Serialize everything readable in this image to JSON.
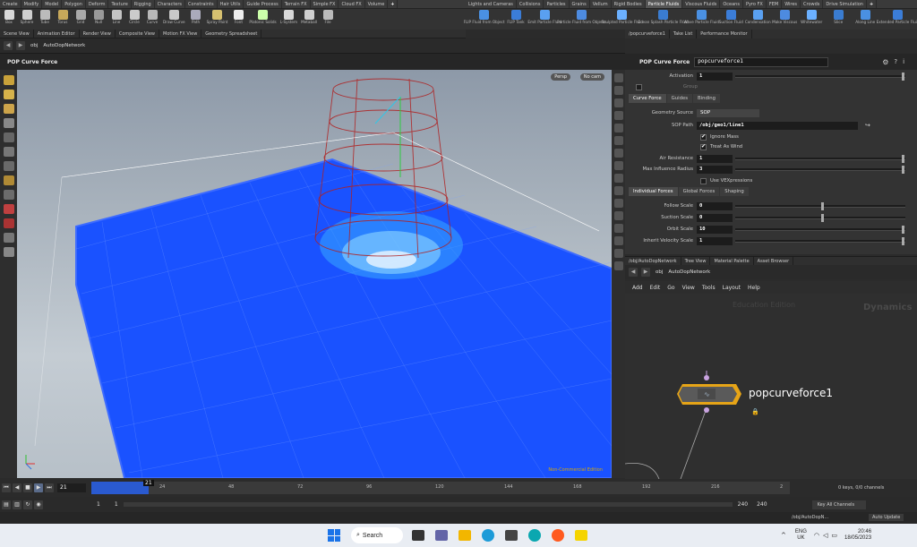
{
  "shelf_tabs_left": [
    "Create",
    "Modify",
    "Model",
    "Polygon",
    "Deform",
    "Texture",
    "Rigging",
    "Characters",
    "Constraints",
    "Hair Utils",
    "Guide Process",
    "Terrain FX",
    "Simple FX",
    "Cloud FX",
    "Volume",
    "+"
  ],
  "shelf_tabs_right": [
    "Lights and Cameras",
    "Collisions",
    "Particles",
    "Grains",
    "Vellum",
    "Rigid Bodies",
    "Particle Fluids",
    "Viscous Fluids",
    "Oceans",
    "Pyro FX",
    "FEM",
    "Wires",
    "Crowds",
    "Drive Simulation",
    "+"
  ],
  "shelf_tabs_right_active": "Particle Fluids",
  "tools_left": [
    "Box",
    "Sphere",
    "Tube",
    "Torus",
    "Grid",
    "Null",
    "Line",
    "Circle",
    "Curve",
    "Draw Curve",
    "Path",
    "Spray Paint",
    "Font",
    "Platonic Solids",
    "L-System",
    "Metaball",
    "File"
  ],
  "tools_right": [
    "FLIP Fluid from Object",
    "FLIP Tank",
    "Emit Particle Fluid",
    "Particle Fluid from Objects",
    "Sculpted Particle Fluid",
    "Ocean Splash Particle Fluid",
    "Wave Particle Fluid",
    "Suction Fluid",
    "Condensation",
    "Make Viscous",
    "Whitewater",
    "Slice",
    "Along Line",
    "Extended Particle Fluid"
  ],
  "pane_tabs_left": [
    "Scene View",
    "Animation Editor",
    "Render View",
    "Composite View",
    "Motion FX View",
    "Geometry Spreadsheet"
  ],
  "pane_tabs_right": [
    "/popcurveforce1",
    "Take List",
    "Performance Monitor"
  ],
  "path_segments": [
    "obj",
    "AutoDopNetwork"
  ],
  "viewport": {
    "title": "POP Curve Force",
    "persp_label": "Persp",
    "cam_label": "No cam",
    "watermark": "Non-Commercial Edition"
  },
  "param_panel": {
    "header_title": "POP Curve Force",
    "node_name": "popcurveforce1",
    "activation_label": "Activation",
    "activation_value": "1",
    "group_label": "Group",
    "tabs": [
      "Curve Force",
      "Guides",
      "Binding"
    ],
    "geometry_source_label": "Geometry Source",
    "geometry_source_value": "SOP",
    "sop_path_label": "SOP Path",
    "sop_path_value": "/obj/geo1/line1",
    "ignore_mass_label": "Ignore Mass",
    "treat_as_wind_label": "Treat As Wind",
    "air_resistance_label": "Air Resistance",
    "air_resistance_value": "1",
    "max_influence_label": "Max Influence Radius",
    "max_influence_value": "3",
    "use_vex_label": "Use VEXpressions",
    "subtabs": [
      "Individual Forces",
      "Global Forces",
      "Shaping"
    ],
    "follow_scale_label": "Follow Scale",
    "follow_scale_value": "0",
    "suction_scale_label": "Suction Scale",
    "suction_scale_value": "0",
    "orbit_scale_label": "Orbit Scale",
    "orbit_scale_value": "10",
    "inherit_velocity_label": "Inherit Velocity Scale",
    "inherit_velocity_value": "1"
  },
  "network": {
    "tabs": [
      "/obj/AutoDopNetwork",
      "Tree View",
      "Material Palette",
      "Asset Browser"
    ],
    "path_segments": [
      "obj",
      "AutoDopNetwork"
    ],
    "menu": [
      "Add",
      "Edit",
      "Go",
      "View",
      "Tools",
      "Layout",
      "Help"
    ],
    "edition_text": "Education Edition",
    "context_text": "Dynamics",
    "node_label": "popcurveforce1"
  },
  "timeline": {
    "current_frame": "21",
    "ticks": [
      "24",
      "48",
      "72",
      "96",
      "120",
      "144",
      "168",
      "192",
      "216",
      "2"
    ],
    "marker": "21",
    "range_start_a": "1",
    "range_start_b": "1",
    "range_end_a": "240",
    "range_end_b": "240",
    "keys_info": "0 keys, 0/0 channels",
    "key_all_label": "Key All Channels",
    "auto_update_label": "Auto Update",
    "status_path": "/obj/AutoDopN..."
  },
  "taskbar": {
    "search_label": "Search",
    "lang_top": "ENG",
    "lang_bottom": "UK",
    "time": "20:46",
    "date": "18/05/2023"
  },
  "colors": {
    "particles": "#1a52ff",
    "cylinder": "#b02020",
    "node_border": "#e6a417",
    "accent_yellow": "#d8a800"
  }
}
